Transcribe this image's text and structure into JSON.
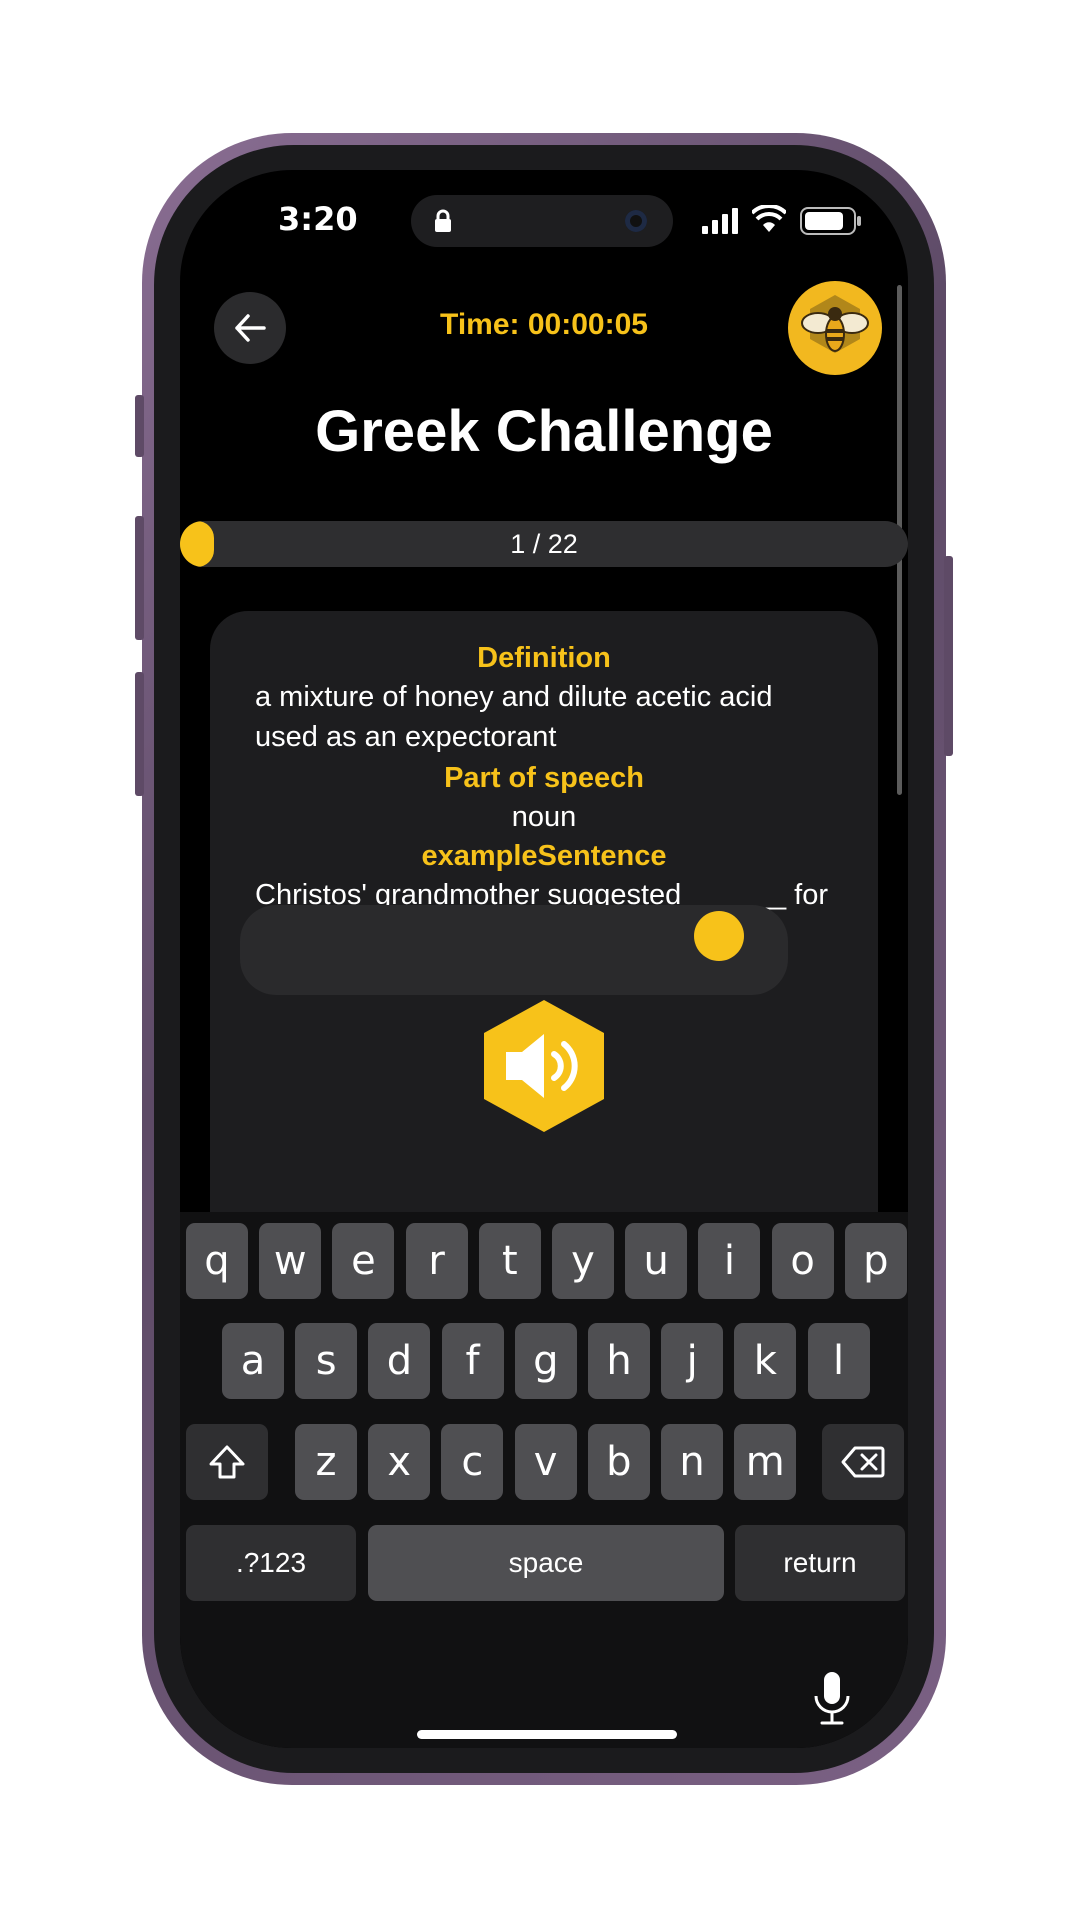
{
  "status": {
    "time": "3:20"
  },
  "header": {
    "timer": "Time: 00:00:05"
  },
  "page": {
    "title": "Greek Challenge"
  },
  "progress": {
    "label": "1 / 22",
    "current": 1,
    "total": 22
  },
  "card": {
    "definition_heading": "Definition",
    "definition": "a mixture of honey and dilute acetic acid used as an expectorant",
    "pos_heading": "Part of speech",
    "pos": "noun",
    "example_heading": "exampleSentence",
    "example": "Christos' grandmother suggested ______ for his congestion."
  },
  "keyboard": {
    "row1": [
      "q",
      "w",
      "e",
      "r",
      "t",
      "y",
      "u",
      "i",
      "o",
      "p"
    ],
    "row2": [
      "a",
      "s",
      "d",
      "f",
      "g",
      "h",
      "j",
      "k",
      "l"
    ],
    "row3": [
      "z",
      "x",
      "c",
      "v",
      "b",
      "n",
      "m"
    ],
    "numbers": ".?123",
    "space": "space",
    "return": "return"
  },
  "colors": {
    "accent": "#f7c21a",
    "background": "#000000",
    "card": "#1d1d1f"
  }
}
